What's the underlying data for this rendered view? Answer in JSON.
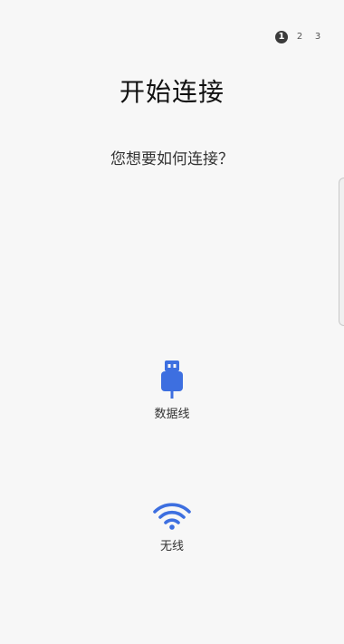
{
  "stepper": {
    "steps": [
      "1",
      "2",
      "3"
    ],
    "current": 1
  },
  "page": {
    "title": "开始连接",
    "question": "您想要如何连接？"
  },
  "options": {
    "cable": {
      "label": "数据线",
      "icon": "usb-cable-icon"
    },
    "wireless": {
      "label": "无线",
      "icon": "wifi-icon"
    }
  },
  "colors": {
    "accent": "#3d6fe0",
    "active_step": "#3b3b3b"
  }
}
